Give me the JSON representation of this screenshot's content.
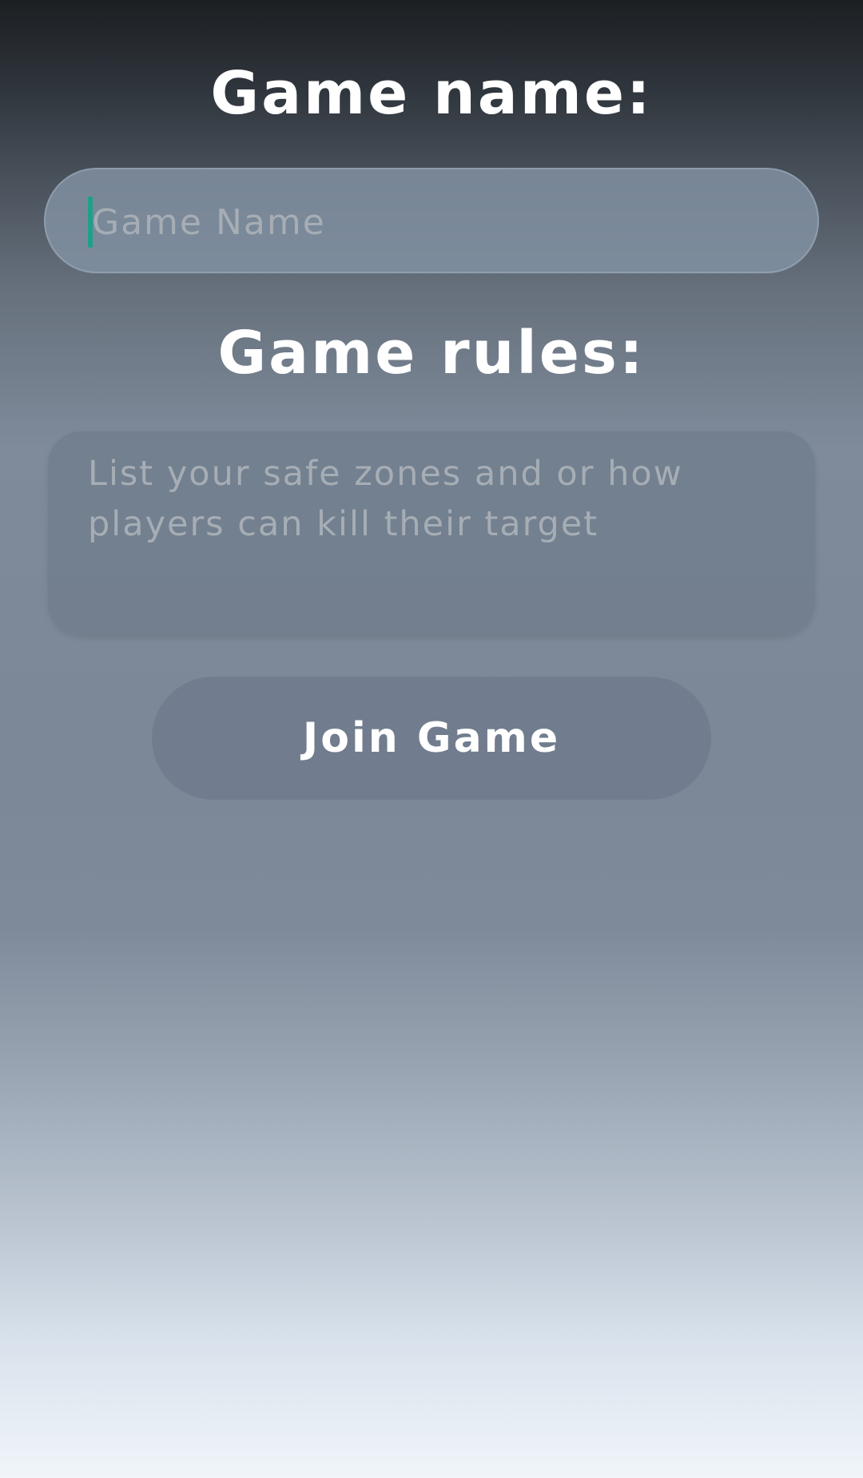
{
  "form": {
    "name_heading": "Game name:",
    "name_input": {
      "value": "",
      "placeholder": "Game Name"
    },
    "rules_heading": "Game rules:",
    "rules_input": {
      "value": "",
      "placeholder": "List your safe zones and or how players can kill their target"
    },
    "join_button_label": "Join Game"
  },
  "colors": {
    "cursor_accent": "#1fa08a",
    "button_background": "#717d8e",
    "heading_text": "#ffffff",
    "placeholder_text": "#a6adb5"
  }
}
